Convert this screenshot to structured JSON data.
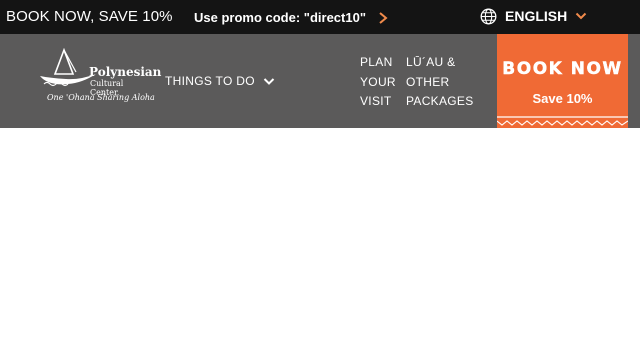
{
  "promo_bar": {
    "headline": "BOOK NOW, SAVE 10%",
    "promo_text": "Use promo code: \"direct10\"",
    "arrow_icon": "chevron-right-icon"
  },
  "language": {
    "label": "ENGLISH",
    "icon": "globe-icon",
    "caret_icon": "chevron-down-icon"
  },
  "logo": {
    "name": "Polynesian",
    "name_line2": "Cultural Center",
    "tagline": "One 'Ohana Sharing Aloha"
  },
  "nav": {
    "things_to_do": "THINGS TO DO",
    "plan_visit": "PLAN YOUR VISIT",
    "luau_packages": "LŪ´AU & OTHER PACKAGES"
  },
  "cta": {
    "title": "BOOK NOW",
    "subtitle": "Save 10%"
  },
  "colors": {
    "top_bar": "#141414",
    "nav_bar": "#5b5a5a",
    "accent_orange": "#f06a35",
    "arrow_orange": "#f08a4b"
  }
}
